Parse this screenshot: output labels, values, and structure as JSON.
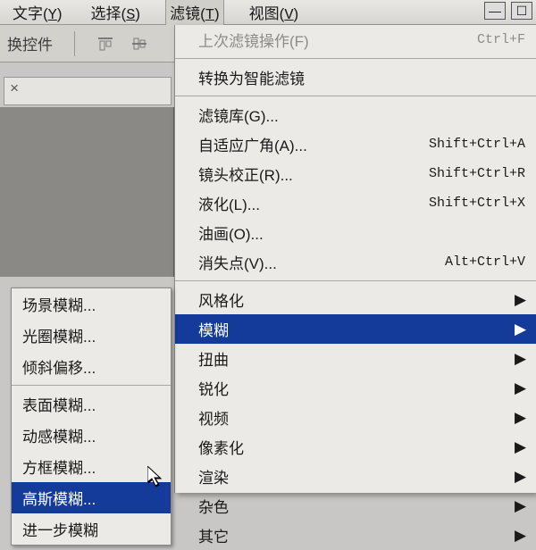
{
  "menubar": {
    "items": [
      {
        "label": "文字",
        "mn": "Y"
      },
      {
        "label": "选择",
        "mn": "S"
      },
      {
        "label": "滤镜",
        "mn": "T",
        "active": true
      },
      {
        "label": "视图",
        "mn": "V"
      }
    ]
  },
  "optionsbar": {
    "label": "换控件"
  },
  "winbuttons": {
    "min": "—",
    "max": "☐"
  },
  "tabwell": {
    "close": "×"
  },
  "dropdown": {
    "last_label": "上次滤镜操作(F)",
    "last_shortcut": "Ctrl+F",
    "convert": "转换为智能滤镜",
    "group1": [
      {
        "label": "滤镜库(G)...",
        "shortcut": ""
      },
      {
        "label": "自适应广角(A)...",
        "shortcut": "Shift+Ctrl+A"
      },
      {
        "label": "镜头校正(R)...",
        "shortcut": "Shift+Ctrl+R"
      },
      {
        "label": "液化(L)...",
        "shortcut": "Shift+Ctrl+X"
      },
      {
        "label": "油画(O)...",
        "shortcut": ""
      },
      {
        "label": "消失点(V)...",
        "shortcut": "Alt+Ctrl+V"
      }
    ],
    "group2": [
      {
        "label": "风格化"
      },
      {
        "label": "模糊",
        "highlight": true
      },
      {
        "label": "扭曲"
      },
      {
        "label": "锐化"
      },
      {
        "label": "视频"
      },
      {
        "label": "像素化"
      },
      {
        "label": "渲染"
      },
      {
        "label": "杂色"
      },
      {
        "label": "其它"
      }
    ]
  },
  "submenu": {
    "group1": [
      "场景模糊...",
      "光圈模糊...",
      "倾斜偏移..."
    ],
    "group2": [
      {
        "label": "表面模糊..."
      },
      {
        "label": "动感模糊..."
      },
      {
        "label": "方框模糊..."
      },
      {
        "label": "高斯模糊...",
        "highlight": true
      },
      {
        "label": "进一步模糊"
      }
    ]
  }
}
